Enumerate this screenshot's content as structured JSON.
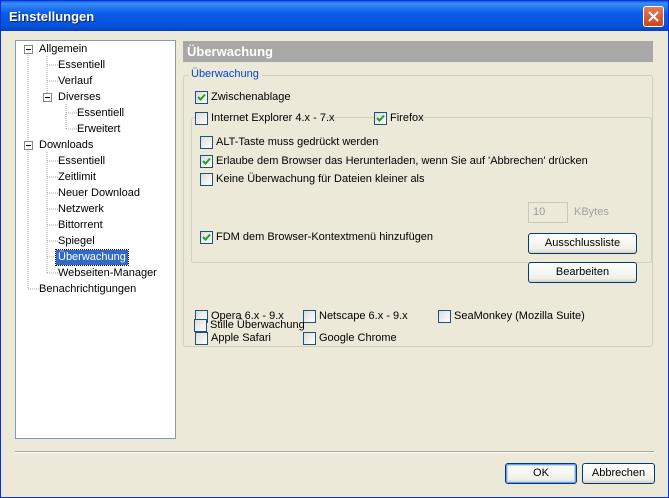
{
  "window": {
    "title": "Einstellungen"
  },
  "tree": {
    "allgemein": "Allgemein",
    "essentiell1": "Essentiell",
    "verlauf": "Verlauf",
    "diverses": "Diverses",
    "essentiell2": "Essentiell",
    "erweitert": "Erweitert",
    "downloads": "Downloads",
    "essentiell3": "Essentiell",
    "zeitlimit": "Zeitlimit",
    "neuer_download": "Neuer Download",
    "netzwerk": "Netzwerk",
    "bittorrent": "Bittorrent",
    "spiegel": "Spiegel",
    "ueberwachung": "Überwachung",
    "webseiten_manager": "Webseiten-Manager",
    "benachrichtigungen": "Benachrichtigungen"
  },
  "panel": {
    "header": "Überwachung",
    "group_label": "Überwachung",
    "zwischenablage": {
      "label": "Zwischenablage",
      "checked": true
    },
    "ie": {
      "label": "Internet Explorer 4.x - 7.x",
      "checked": false
    },
    "firefox": {
      "label": "Firefox",
      "checked": true
    },
    "alt_taste": {
      "label": "ALT-Taste muss gedrückt werden",
      "checked": false
    },
    "erlaube": {
      "label": "Erlaube dem Browser das Herunterladen, wenn Sie auf 'Abbrechen' drücken",
      "checked": true
    },
    "keine_ueberwachung": {
      "label": "Keine Überwachung für Dateien kleiner als",
      "checked": false
    },
    "size_value": "10",
    "size_unit": "KBytes",
    "ausschlussliste": "Ausschlussliste",
    "fdm_kontext": {
      "label": "FDM dem Browser-Kontextmenü hinzufügen",
      "checked": true
    },
    "bearbeiten": "Bearbeiten",
    "opera": {
      "label": "Opera 6.x - 9.x",
      "checked": false
    },
    "netscape": {
      "label": "Netscape 6.x - 9.x",
      "checked": false
    },
    "seamonkey": {
      "label": "SeaMonkey (Mozilla Suite)",
      "checked": false
    },
    "safari": {
      "label": "Apple Safari",
      "checked": false
    },
    "chrome": {
      "label": "Google Chrome",
      "checked": false
    },
    "stille": {
      "label": "Stille Überwachung",
      "checked": false
    }
  },
  "footer": {
    "ok": "OK",
    "cancel": "Abbrechen"
  }
}
